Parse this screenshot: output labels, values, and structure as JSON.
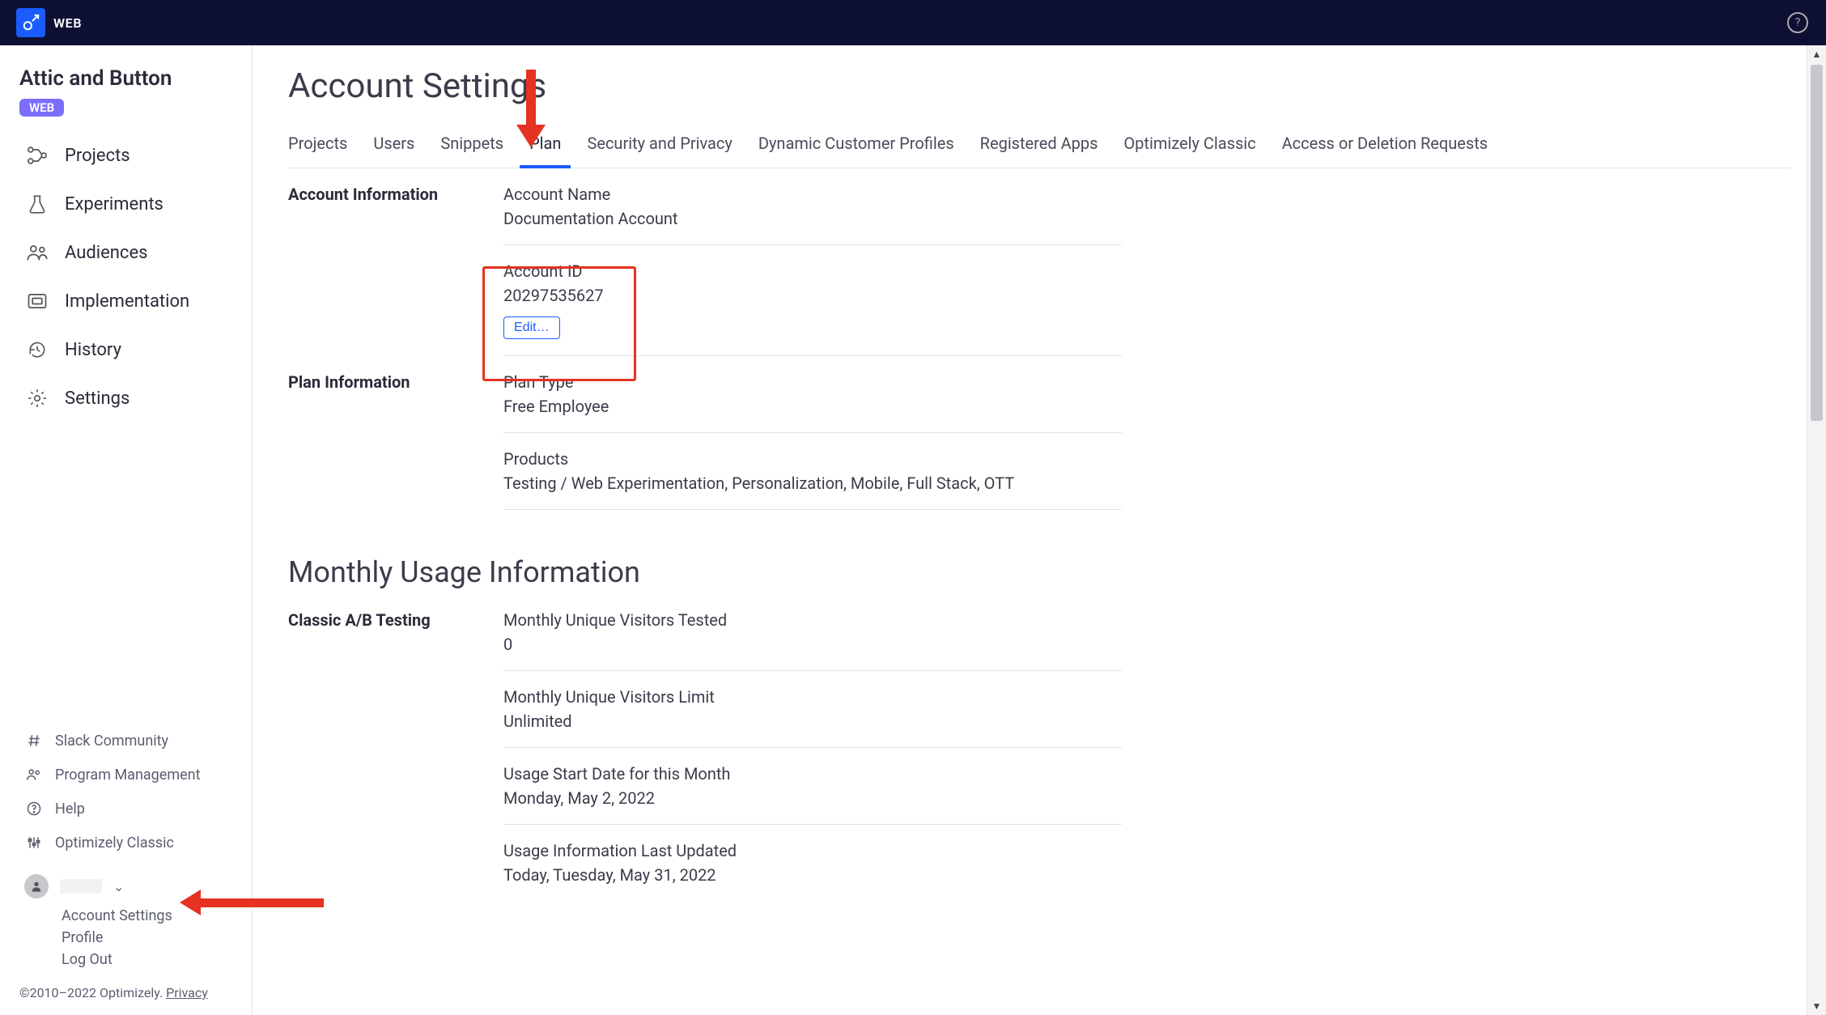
{
  "topbar": {
    "brand": "WEB"
  },
  "sidebar": {
    "project_title": "Attic and Button",
    "pill": "WEB",
    "nav": [
      {
        "label": "Projects"
      },
      {
        "label": "Experiments"
      },
      {
        "label": "Audiences"
      },
      {
        "label": "Implementation"
      },
      {
        "label": "History"
      },
      {
        "label": "Settings"
      }
    ],
    "secondary": [
      {
        "label": "Slack Community"
      },
      {
        "label": "Program Management"
      },
      {
        "label": "Help"
      },
      {
        "label": "Optimizely Classic"
      }
    ],
    "user_menu": {
      "account_settings": "Account Settings",
      "profile": "Profile",
      "logout": "Log Out"
    },
    "copyright_prefix": "©2010–2022 Optimizely. ",
    "privacy": "Privacy"
  },
  "main": {
    "title": "Account Settings",
    "tabs": [
      {
        "label": "Projects"
      },
      {
        "label": "Users"
      },
      {
        "label": "Snippets"
      },
      {
        "label": "Plan",
        "active": true
      },
      {
        "label": "Security and Privacy"
      },
      {
        "label": "Dynamic Customer Profiles"
      },
      {
        "label": "Registered Apps"
      },
      {
        "label": "Optimizely Classic"
      },
      {
        "label": "Access or Deletion Requests"
      }
    ],
    "account_info": {
      "section_label": "Account Information",
      "name_label": "Account Name",
      "name_value": "Documentation Account",
      "id_label": "Account ID",
      "id_value": "20297535627",
      "edit": "Edit…"
    },
    "plan_info": {
      "section_label": "Plan Information",
      "type_label": "Plan Type",
      "type_value": "Free Employee",
      "products_label": "Products",
      "products_value": "Testing / Web Experimentation, Personalization, Mobile, Full Stack, OTT"
    },
    "monthly": {
      "title": "Monthly Usage Information",
      "ab_label": "Classic A/B Testing",
      "tested_label": "Monthly Unique Visitors Tested",
      "tested_value": "0",
      "limit_label": "Monthly Unique Visitors Limit",
      "limit_value": "Unlimited",
      "start_label": "Usage Start Date for this Month",
      "start_value": "Monday, May 2, 2022",
      "updated_label": "Usage Information Last Updated",
      "updated_value": "Today, Tuesday, May 31, 2022"
    }
  }
}
